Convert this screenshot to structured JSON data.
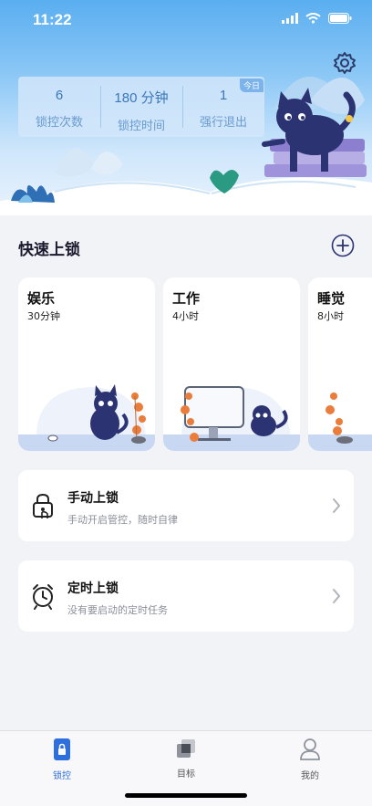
{
  "status_bar": {
    "time": "11:22"
  },
  "stats": {
    "badge": "今日",
    "items": [
      {
        "value": "6",
        "label": "锁控次数"
      },
      {
        "value": "180 分钟",
        "label": "锁控时间"
      },
      {
        "value": "1",
        "label": "强行退出"
      }
    ]
  },
  "quick_lock": {
    "title": "快速上锁",
    "cards": [
      {
        "title": "娱乐",
        "duration": "30分钟"
      },
      {
        "title": "工作",
        "duration": "4小时"
      },
      {
        "title": "睡觉",
        "duration": "8小时"
      }
    ]
  },
  "manual_lock": {
    "title": "手动上锁",
    "subtitle": "手动开启管控，随时自律"
  },
  "timed_lock": {
    "title": "定时上锁",
    "subtitle": "没有要启动的定时任务"
  },
  "tabs": [
    {
      "label": "锁控",
      "active": true
    },
    {
      "label": "目标",
      "active": false
    },
    {
      "label": "我的",
      "active": false
    }
  ],
  "colors": {
    "accent": "#2e6fe0",
    "cat": "#2c3372",
    "plant": "#ea7d3c",
    "sky": "#5aaef0"
  },
  "icons": [
    "settings-gear-icon",
    "add-circle-icon",
    "padlock-hand-icon",
    "alarm-clock-icon",
    "chevron-right-icon",
    "lock-phone-icon",
    "target-icon",
    "user-icon",
    "signal-icon",
    "wifi-icon",
    "battery-icon"
  ]
}
